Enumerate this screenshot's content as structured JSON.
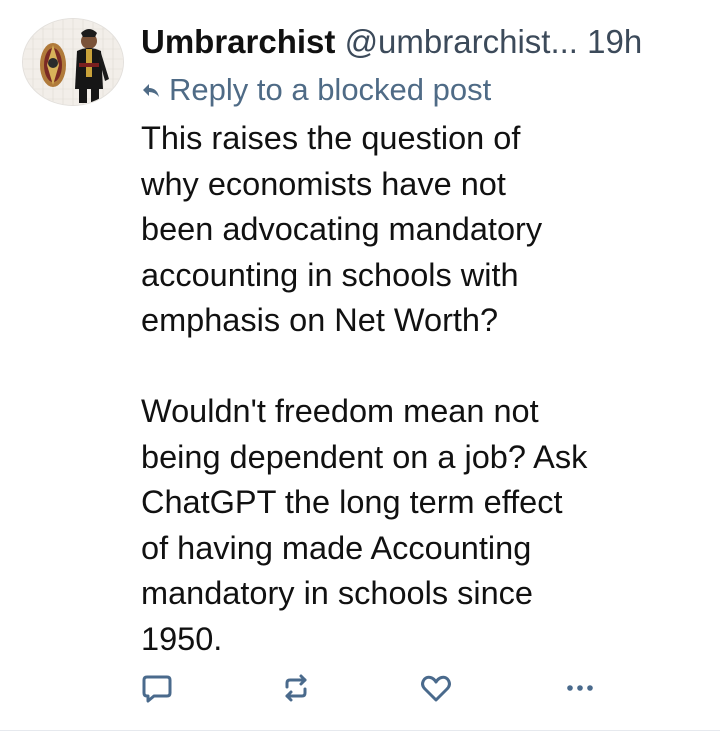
{
  "post": {
    "author": {
      "display_name": "Umbrarchist",
      "handle": "@umbrarchist...",
      "avatar_icon": "avatar-figure-icon"
    },
    "timestamp": "19h",
    "reply_context": {
      "icon": "reply-arrow-icon",
      "text": "Reply to a blocked post"
    },
    "body": {
      "paragraphs": [
        [
          "This raises the question of",
          "why economists have not",
          "been advocating mandatory",
          "accounting in schools with",
          "emphasis on Net Worth?"
        ],
        [
          "Wouldn't freedom mean not",
          "being dependent on a job? Ask",
          "ChatGPT the long term effect",
          "of having made Accounting",
          "mandatory in schools since",
          "1950."
        ]
      ]
    },
    "actions": [
      {
        "icon": "comment-icon"
      },
      {
        "icon": "repost-icon"
      },
      {
        "icon": "heart-icon"
      },
      {
        "icon": "more-options-icon"
      }
    ]
  },
  "colors": {
    "accent": "#4f6b86",
    "icon": "#4a6a8c",
    "text": "#111111",
    "secondary": "#3c4a5a"
  }
}
